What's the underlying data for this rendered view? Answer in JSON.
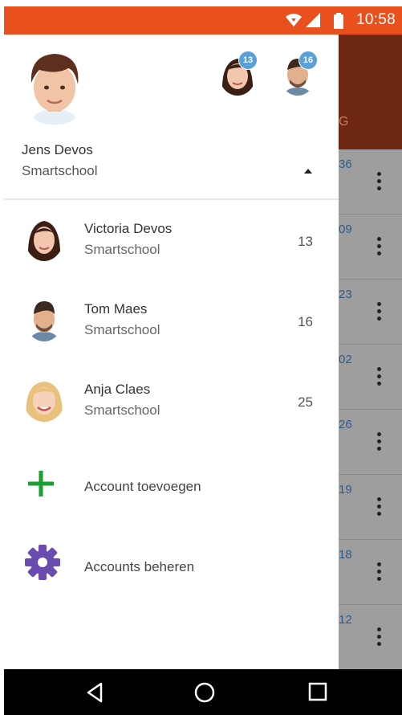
{
  "status_bar": {
    "time": "10:58",
    "icons": [
      "wifi-icon",
      "signal-icon",
      "battery-icon"
    ]
  },
  "background_app": {
    "tab_fragment": "G",
    "rows": [
      "36",
      "09",
      "23",
      "02",
      "26",
      "19",
      "18",
      "12"
    ]
  },
  "drawer": {
    "current_account": {
      "name": "Jens Devos",
      "school": "Smartschool"
    },
    "switch_badges": [
      "13",
      "16"
    ],
    "accounts": [
      {
        "name": "Victoria Devos",
        "school": "Smartschool",
        "count": "13"
      },
      {
        "name": "Tom Maes",
        "school": "Smartschool",
        "count": "16"
      },
      {
        "name": "Anja Claes",
        "school": "Smartschool",
        "count": "25"
      }
    ],
    "actions": {
      "add": "Account toevoegen",
      "manage": "Accounts beheren"
    }
  },
  "colors": {
    "status_bar": "#e8511e",
    "add_icon": "#1aa030",
    "manage_icon": "#6a4bb0",
    "badge": "#5a9fd6"
  }
}
